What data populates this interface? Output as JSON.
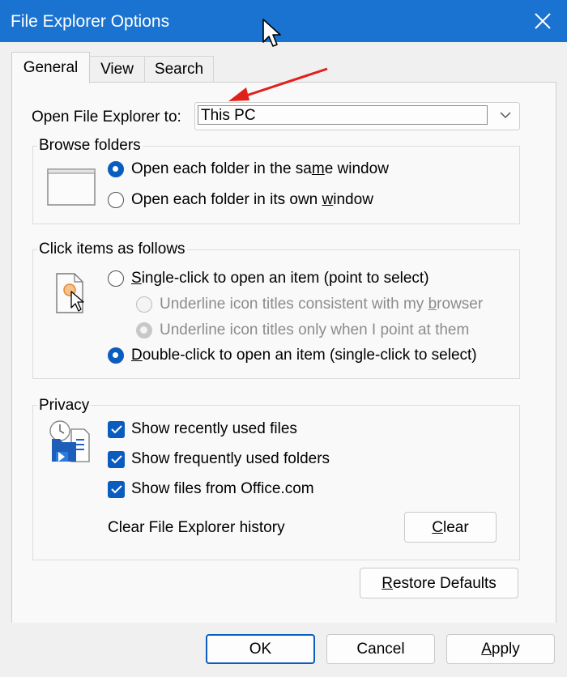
{
  "window": {
    "title": "File Explorer Options"
  },
  "tabs": [
    {
      "label": "General",
      "active": true
    },
    {
      "label": "View",
      "active": false
    },
    {
      "label": "Search",
      "active": false
    }
  ],
  "open_to": {
    "label": "Open File Explorer to:",
    "value": "This PC"
  },
  "browse_folders": {
    "title": "Browse folders",
    "options": [
      {
        "pre": "Open each folder in the sa",
        "ul": "m",
        "post": "e window",
        "checked": true
      },
      {
        "pre": "Open each folder in its own ",
        "ul": "w",
        "post": "indow",
        "checked": false
      }
    ]
  },
  "click_items": {
    "title": "Click items as follows",
    "options": [
      {
        "pre": "",
        "ul": "S",
        "post": "ingle-click to open an item (point to select)",
        "checked": false,
        "disabled": false
      },
      {
        "pre": "Underline icon titles consistent with my ",
        "ul": "b",
        "post": "rowser",
        "checked": false,
        "disabled": true
      },
      {
        "pre": "Underline icon titles only when I point at them",
        "ul": "",
        "post": "",
        "checked": true,
        "disabled": true
      },
      {
        "pre": "",
        "ul": "D",
        "post": "ouble-click to open an item (single-click to select)",
        "checked": true,
        "disabled": false
      }
    ]
  },
  "privacy": {
    "title": "Privacy",
    "checks": [
      {
        "label": "Show recently used files",
        "checked": true
      },
      {
        "label": "Show frequently used folders",
        "checked": true
      },
      {
        "label": "Show files from Office.com",
        "checked": true
      }
    ],
    "clear_label": "Clear File Explorer history",
    "clear_button": {
      "ul": "C",
      "post": "lear"
    }
  },
  "restore_button": {
    "ul": "R",
    "post": "estore Defaults"
  },
  "footer": {
    "ok": "OK",
    "cancel": "Cancel",
    "apply_ul": "A",
    "apply_post": "pply"
  },
  "colors": {
    "titlebar": "#1a73d1",
    "accent": "#0a5cbf",
    "annotation_arrow": "#e0201b"
  }
}
